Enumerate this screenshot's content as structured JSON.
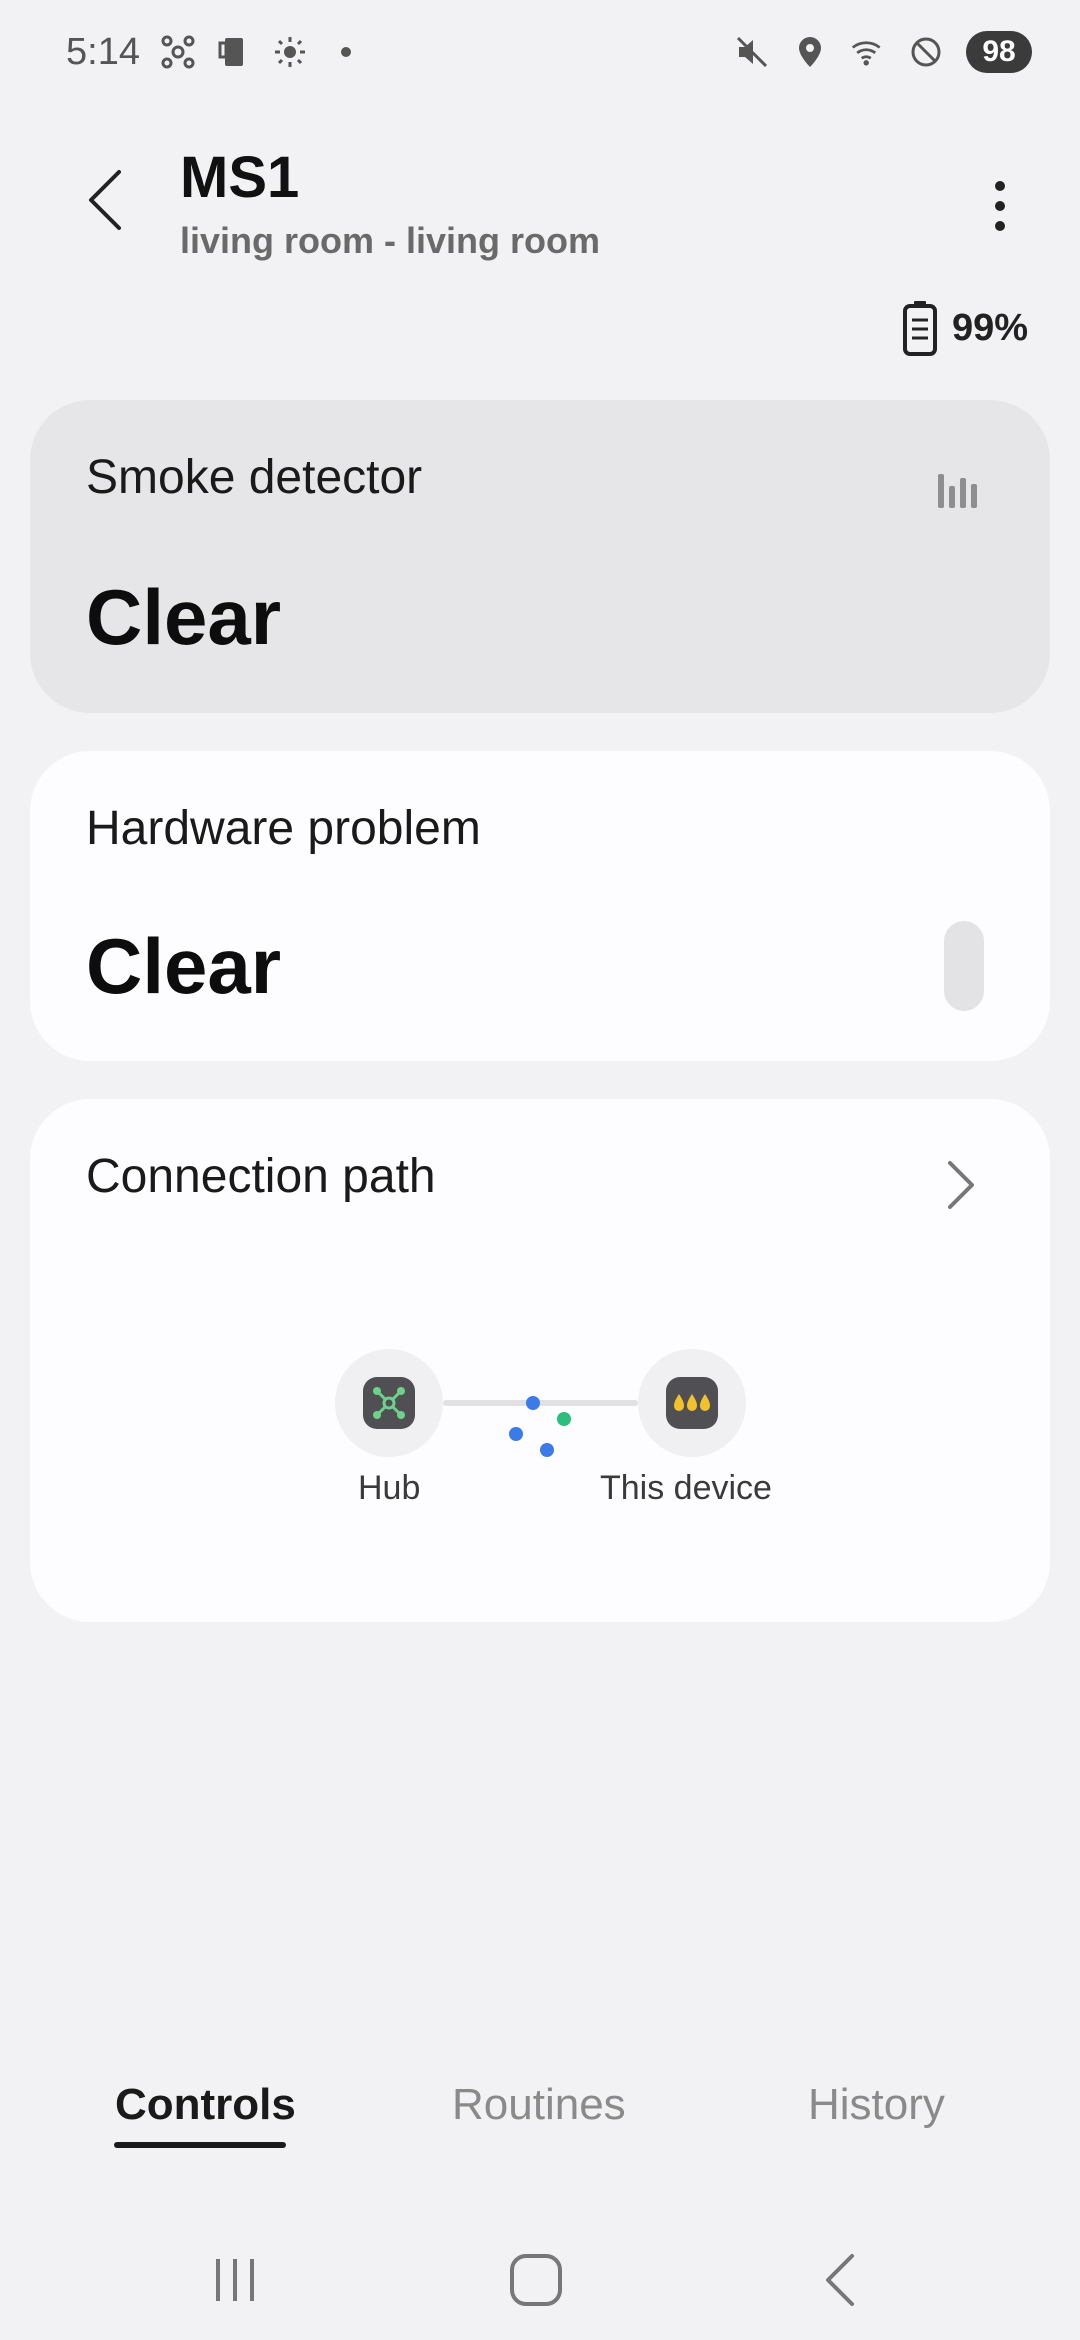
{
  "status_bar": {
    "time": "5:14",
    "battery_level": "98",
    "icons": [
      "hub-network-icon",
      "device-icon",
      "brightness-icon",
      "notification-dot-icon",
      "mute-icon",
      "location-icon",
      "wifi-icon",
      "do-not-disturb-icon"
    ]
  },
  "header": {
    "title": "MS1",
    "location": "living room - living room",
    "back_icon": "back-arrow-icon",
    "more_icon": "more-vertical-icon"
  },
  "battery": {
    "percent": "99%",
    "icon": "battery-icon"
  },
  "cards": {
    "smoke": {
      "label": "Smoke detector",
      "value": "Clear",
      "icon": "history-bars-icon"
    },
    "hardware": {
      "label": "Hardware problem",
      "value": "Clear"
    },
    "connection": {
      "label": "Connection path",
      "hub_label": "Hub",
      "device_label": "This device",
      "hub_icon": "hub-icon",
      "device_icon": "smoke-sensor-icon"
    }
  },
  "tabs": {
    "controls": "Controls",
    "routines": "Routines",
    "history": "History"
  },
  "colors": {
    "background": "#f2f2f4",
    "card": "#fdfcfe",
    "card_active": "#e6e6e8",
    "dot_blue": "#3b7be8",
    "dot_green": "#2dbd7e",
    "hub_green": "#6fd08a",
    "device_yellow": "#f2c12e"
  }
}
